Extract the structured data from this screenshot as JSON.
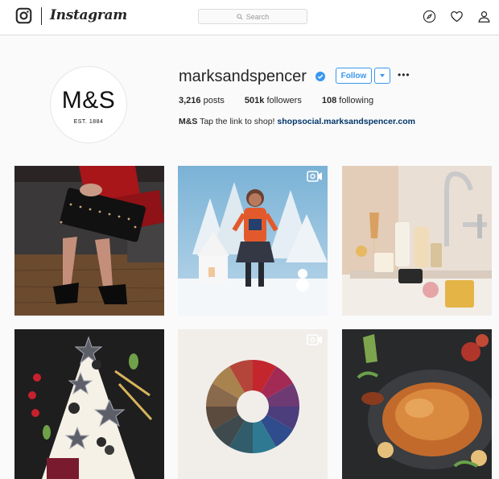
{
  "nav": {
    "wordmark": "Instagram",
    "search_placeholder": "Search",
    "icons": [
      "instagram-glyph-icon",
      "search-icon",
      "explore-compass-icon",
      "heart-icon",
      "profile-icon"
    ]
  },
  "profile": {
    "avatar_mark": "M&S",
    "avatar_est": "EST. 1884",
    "username": "marksandspencer",
    "verified": true,
    "follow_label": "Follow",
    "more_label": "•••",
    "stats": {
      "posts_count": "3,216",
      "posts_label": "posts",
      "followers_count": "501k",
      "followers_label": "followers",
      "following_count": "108",
      "following_label": "following"
    },
    "bio": {
      "name": "M&S",
      "text": "Tap the link to shop!",
      "link": "shopsocial.marksandspencer.com"
    }
  },
  "posts": [
    {
      "subject": "woman in red with studded black clutch and heels",
      "video": false
    },
    {
      "subject": "girl in orange sweater in snowy paper scene",
      "video": true
    },
    {
      "subject": "bathroom toiletries candles and faucet",
      "video": false
    },
    {
      "subject": "star-decorated dessert tree with spoons",
      "video": false
    },
    {
      "subject": "color wheel of knitted fabrics",
      "video": true
    },
    {
      "subject": "roast turkey on slate",
      "video": false
    }
  ],
  "colors": {
    "accent": "#3897f0",
    "link": "#003569",
    "text": "#262626",
    "background": "#fafafa"
  }
}
